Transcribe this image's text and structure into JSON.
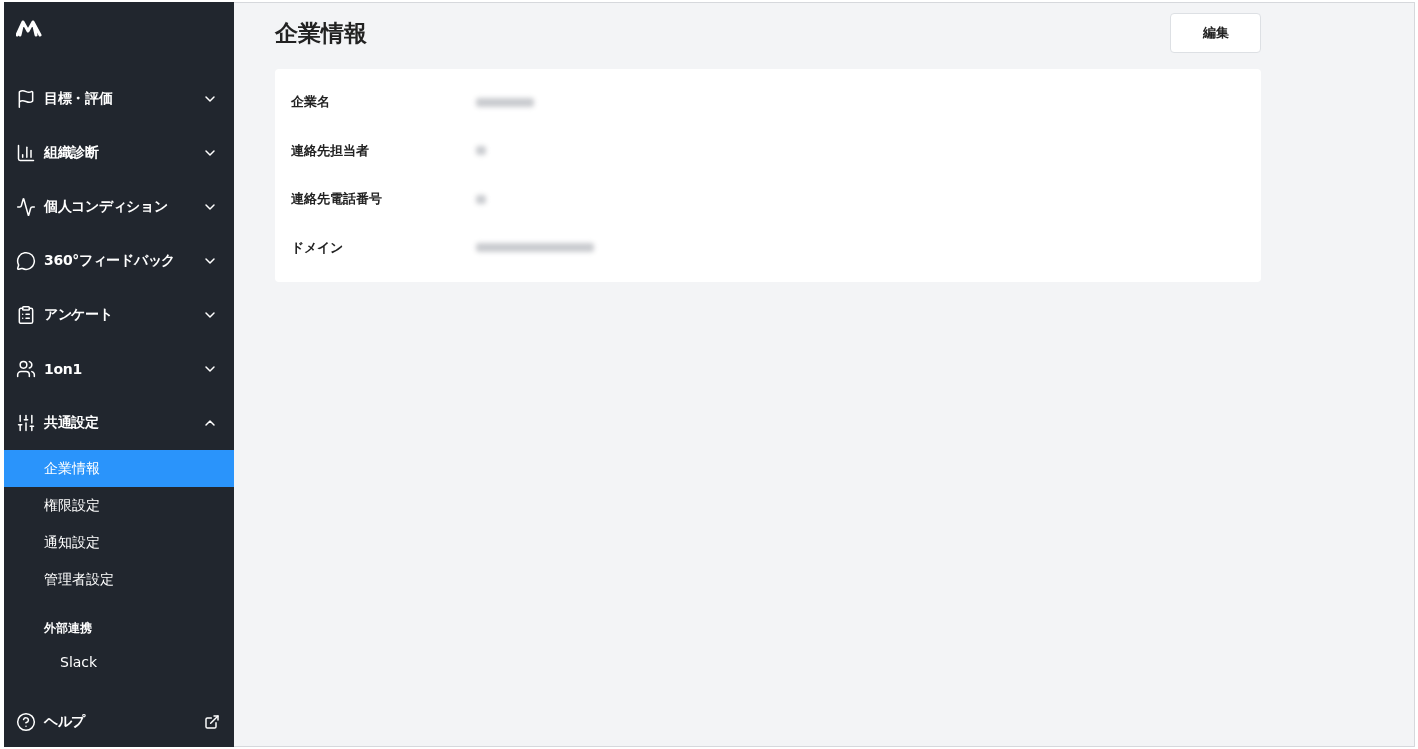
{
  "sidebar": {
    "items": [
      {
        "label": "目標・評価",
        "expanded": false
      },
      {
        "label": "組織診断",
        "expanded": false
      },
      {
        "label": "個人コンディション",
        "expanded": false
      },
      {
        "label": "360°フィードバック",
        "expanded": false
      },
      {
        "label": "アンケート",
        "expanded": false
      },
      {
        "label": "1on1",
        "expanded": false
      },
      {
        "label": "共通設定",
        "expanded": true,
        "children": [
          {
            "kind": "link",
            "label": "企業情報",
            "selected": true
          },
          {
            "kind": "link",
            "label": "権限設定",
            "selected": false
          },
          {
            "kind": "link",
            "label": "通知設定",
            "selected": false
          },
          {
            "kind": "link",
            "label": "管理者設定",
            "selected": false
          },
          {
            "kind": "heading",
            "label": "外部連携",
            "children": [
              {
                "kind": "link",
                "label": "Slack",
                "selected": false
              }
            ]
          }
        ]
      }
    ],
    "help": {
      "label": "ヘルプ"
    }
  },
  "page": {
    "title": "企業情報",
    "edit_button": "編集",
    "fields": [
      {
        "label": "企業名",
        "blurred": true
      },
      {
        "label": "連絡先担当者",
        "blurred": true
      },
      {
        "label": "連絡先電話番号",
        "blurred": true
      },
      {
        "label": "ドメイン",
        "blurred": true
      }
    ]
  }
}
